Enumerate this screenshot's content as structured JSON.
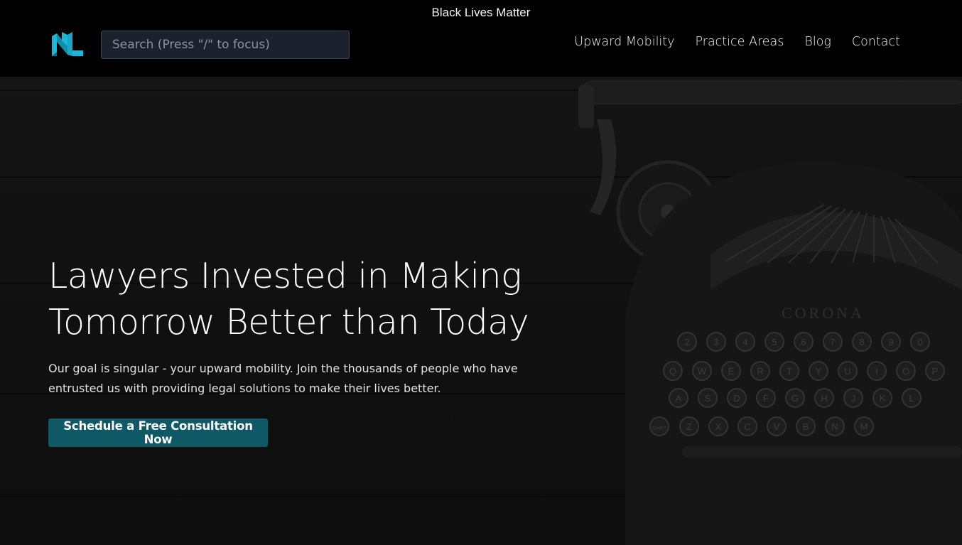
{
  "banner": {
    "text": "Black Lives Matter"
  },
  "header": {
    "logo_alt": "NL",
    "search": {
      "placeholder": "Search (Press \"/\" to focus)",
      "value": ""
    },
    "nav": [
      {
        "label": "Upward Mobility"
      },
      {
        "label": "Practice Areas"
      },
      {
        "label": "Blog"
      },
      {
        "label": "Contact"
      }
    ]
  },
  "hero": {
    "title_line1": "Lawyers Invested in Making",
    "title_line2": "Tomorrow Better than Today",
    "paragraph_line1": "Our goal is singular - your upward mobility. Join the thousands of people who have",
    "paragraph_line2": "entrusted us with providing legal solutions to make their lives better.",
    "cta_label": "Schedule a Free Consultation Now",
    "typewriter_brand": "CORONA",
    "keys_row1": [
      "2",
      "3",
      "4",
      "5",
      "6",
      "7",
      "8",
      "9",
      "0"
    ],
    "keys_row2": [
      "Q",
      "W",
      "E",
      "R",
      "T",
      "Y",
      "U",
      "I",
      "O",
      "P"
    ],
    "keys_row3": [
      "A",
      "S",
      "D",
      "F",
      "G",
      "H",
      "J",
      "K",
      "L"
    ],
    "keys_row4": [
      "Z",
      "X",
      "C",
      "V",
      "B",
      "N",
      "M"
    ],
    "shift_label": "SHIFT"
  },
  "colors": {
    "cta_bg": "#0f5866",
    "logo_accent": "#19b8d8",
    "background": "#000000"
  }
}
